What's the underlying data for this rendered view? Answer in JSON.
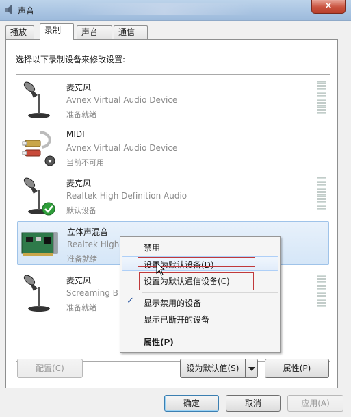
{
  "window": {
    "title": "声音",
    "close_label": "×"
  },
  "tabs": [
    {
      "label": "播放"
    },
    {
      "label": "录制"
    },
    {
      "label": "声音"
    },
    {
      "label": "通信"
    }
  ],
  "instruction": "选择以下录制设备来修改设置:",
  "devices": [
    {
      "name": "麦克风",
      "description": "Avnex Virtual Audio Device",
      "status": "准备就绪",
      "icon": "microphone-icon"
    },
    {
      "name": "MIDI",
      "description": "Avnex Virtual Audio Device",
      "status": "当前不可用",
      "icon": "audio-cable-icon"
    },
    {
      "name": "麦克风",
      "description": "Realtek High Definition Audio",
      "status": "默认设备",
      "icon": "microphone-icon"
    },
    {
      "name": "立体声混音",
      "description": "Realtek High",
      "status": "准备就绪",
      "icon": "sound-card-icon"
    },
    {
      "name": "麦克风",
      "description": "Screaming B",
      "status": "准备就绪",
      "icon": "microphone-icon"
    }
  ],
  "context_menu": {
    "disable": "禁用",
    "set_default": "设置为默认设备(D)",
    "set_default_comm": "设置为默认通信设备(C)",
    "show_disabled": "显示禁用的设备",
    "show_disconnected": "显示已断开的设备",
    "properties": "属性(P)",
    "check_mark": "✓"
  },
  "buttons": {
    "configure": "配置(C)",
    "set_default": "设为默认值(S)",
    "properties": "属性(P)",
    "ok": "确定",
    "cancel": "取消",
    "apply": "应用(A)"
  },
  "colors": {
    "accent": "#3c7fb1",
    "highlight_box": "#c0393b",
    "default_check": "#2f9e3a"
  }
}
